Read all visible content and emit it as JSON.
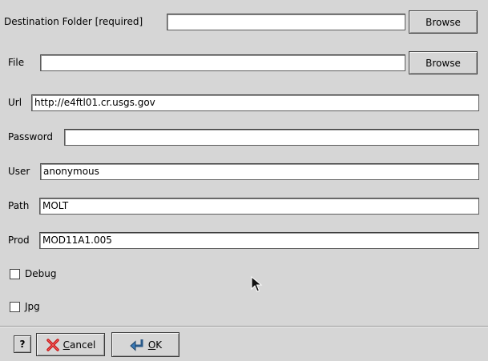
{
  "form": {
    "destination": {
      "label": "Destination Folder [required]",
      "value": "",
      "browse": "Browse"
    },
    "file": {
      "label": "File",
      "value": "",
      "browse": "Browse"
    },
    "url": {
      "label": "Url",
      "value": "http://e4ftl01.cr.usgs.gov"
    },
    "password": {
      "label": "Password",
      "value": ""
    },
    "user": {
      "label": "User",
      "value": "anonymous"
    },
    "path": {
      "label": "Path",
      "value": "MOLT"
    },
    "prod": {
      "label": "Prod",
      "value": "MOD11A1.005"
    },
    "debug": {
      "label": "Debug",
      "checked": false
    },
    "jpg": {
      "label": "Jpg",
      "checked": false
    }
  },
  "buttons": {
    "help": "?",
    "cancel_first": "C",
    "cancel_rest": "ancel",
    "ok_first": "O",
    "ok_rest": "K"
  },
  "icons": {
    "cancel": "red-x-icon",
    "ok": "return-arrow-icon",
    "cursor": "mouse-pointer-icon"
  }
}
